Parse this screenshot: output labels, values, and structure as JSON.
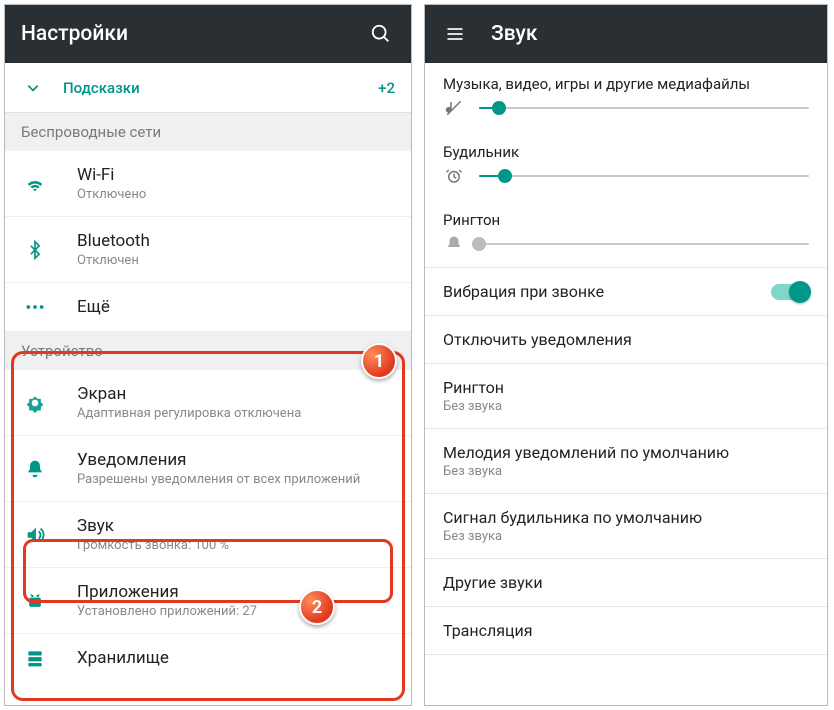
{
  "left": {
    "header_title": "Настройки",
    "hints_label": "Подсказки",
    "hints_count": "+2",
    "section_wireless": "Беспроводные сети",
    "wifi_title": "Wi-Fi",
    "wifi_sub": "Отключено",
    "bt_title": "Bluetooth",
    "bt_sub": "Отключен",
    "more_title": "Ещё",
    "section_device": "Устройство",
    "screen_title": "Экран",
    "screen_sub": "Адаптивная регулировка отключена",
    "notif_title": "Уведомления",
    "notif_sub": "Разрешены уведомления от всех приложений",
    "sound_title": "Звук",
    "sound_sub": "Громкость звонка: 100 %",
    "apps_title": "Приложения",
    "apps_sub": "Установлено приложений: 27",
    "storage_title": "Хранилище"
  },
  "right": {
    "header_title": "Звук",
    "media_label": "Музыка, видео, игры и другие медиафайлы",
    "media_pct": 6,
    "alarm_label": "Будильник",
    "alarm_pct": 8,
    "ringtone_label": "Рингтон",
    "ringtone_pct": 0,
    "vibrate_title": "Вибрация при звонке",
    "dnd_title": "Отключить уведомления",
    "ring_title": "Рингтон",
    "ring_sub": "Без звука",
    "notifsound_title": "Мелодия уведомлений по умолчанию",
    "notifsound_sub": "Без звука",
    "alarmsound_title": "Сигнал будильника по умолчанию",
    "alarmsound_sub": "Без звука",
    "other_title": "Другие звуки",
    "cast_title": "Трансляция"
  },
  "badges": {
    "one": "1",
    "two": "2"
  }
}
